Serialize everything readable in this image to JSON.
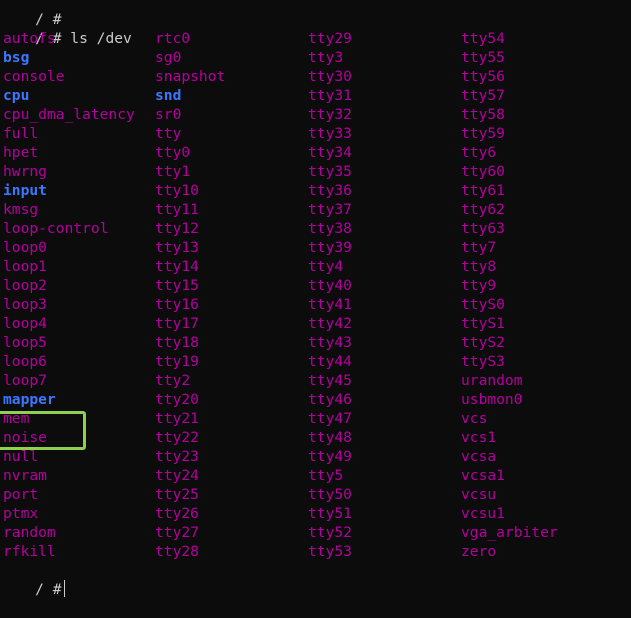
{
  "terminal": {
    "lines_before": [
      "/ #",
      "/ # ls /dev"
    ],
    "final_prompt": "/ #"
  },
  "listing": [
    [
      {
        "n": "autofs",
        "t": "file"
      },
      {
        "n": "rtc0",
        "t": "file"
      },
      {
        "n": "tty29",
        "t": "file"
      },
      {
        "n": "tty54",
        "t": "file"
      }
    ],
    [
      {
        "n": "bsg",
        "t": "dir"
      },
      {
        "n": "sg0",
        "t": "file"
      },
      {
        "n": "tty3",
        "t": "file"
      },
      {
        "n": "tty55",
        "t": "file"
      }
    ],
    [
      {
        "n": "console",
        "t": "file"
      },
      {
        "n": "snapshot",
        "t": "file"
      },
      {
        "n": "tty30",
        "t": "file"
      },
      {
        "n": "tty56",
        "t": "file"
      }
    ],
    [
      {
        "n": "cpu",
        "t": "dir"
      },
      {
        "n": "snd",
        "t": "dir"
      },
      {
        "n": "tty31",
        "t": "file"
      },
      {
        "n": "tty57",
        "t": "file"
      }
    ],
    [
      {
        "n": "cpu_dma_latency",
        "t": "file"
      },
      {
        "n": "sr0",
        "t": "file"
      },
      {
        "n": "tty32",
        "t": "file"
      },
      {
        "n": "tty58",
        "t": "file"
      }
    ],
    [
      {
        "n": "full",
        "t": "file"
      },
      {
        "n": "tty",
        "t": "file"
      },
      {
        "n": "tty33",
        "t": "file"
      },
      {
        "n": "tty59",
        "t": "file"
      }
    ],
    [
      {
        "n": "hpet",
        "t": "file"
      },
      {
        "n": "tty0",
        "t": "file"
      },
      {
        "n": "tty34",
        "t": "file"
      },
      {
        "n": "tty6",
        "t": "file"
      }
    ],
    [
      {
        "n": "hwrng",
        "t": "file"
      },
      {
        "n": "tty1",
        "t": "file"
      },
      {
        "n": "tty35",
        "t": "file"
      },
      {
        "n": "tty60",
        "t": "file"
      }
    ],
    [
      {
        "n": "input",
        "t": "dir"
      },
      {
        "n": "tty10",
        "t": "file"
      },
      {
        "n": "tty36",
        "t": "file"
      },
      {
        "n": "tty61",
        "t": "file"
      }
    ],
    [
      {
        "n": "kmsg",
        "t": "file"
      },
      {
        "n": "tty11",
        "t": "file"
      },
      {
        "n": "tty37",
        "t": "file"
      },
      {
        "n": "tty62",
        "t": "file"
      }
    ],
    [
      {
        "n": "loop-control",
        "t": "file"
      },
      {
        "n": "tty12",
        "t": "file"
      },
      {
        "n": "tty38",
        "t": "file"
      },
      {
        "n": "tty63",
        "t": "file"
      }
    ],
    [
      {
        "n": "loop0",
        "t": "file"
      },
      {
        "n": "tty13",
        "t": "file"
      },
      {
        "n": "tty39",
        "t": "file"
      },
      {
        "n": "tty7",
        "t": "file"
      }
    ],
    [
      {
        "n": "loop1",
        "t": "file"
      },
      {
        "n": "tty14",
        "t": "file"
      },
      {
        "n": "tty4",
        "t": "file"
      },
      {
        "n": "tty8",
        "t": "file"
      }
    ],
    [
      {
        "n": "loop2",
        "t": "file"
      },
      {
        "n": "tty15",
        "t": "file"
      },
      {
        "n": "tty40",
        "t": "file"
      },
      {
        "n": "tty9",
        "t": "file"
      }
    ],
    [
      {
        "n": "loop3",
        "t": "file"
      },
      {
        "n": "tty16",
        "t": "file"
      },
      {
        "n": "tty41",
        "t": "file"
      },
      {
        "n": "ttyS0",
        "t": "file"
      }
    ],
    [
      {
        "n": "loop4",
        "t": "file"
      },
      {
        "n": "tty17",
        "t": "file"
      },
      {
        "n": "tty42",
        "t": "file"
      },
      {
        "n": "ttyS1",
        "t": "file"
      }
    ],
    [
      {
        "n": "loop5",
        "t": "file"
      },
      {
        "n": "tty18",
        "t": "file"
      },
      {
        "n": "tty43",
        "t": "file"
      },
      {
        "n": "ttyS2",
        "t": "file"
      }
    ],
    [
      {
        "n": "loop6",
        "t": "file"
      },
      {
        "n": "tty19",
        "t": "file"
      },
      {
        "n": "tty44",
        "t": "file"
      },
      {
        "n": "ttyS3",
        "t": "file"
      }
    ],
    [
      {
        "n": "loop7",
        "t": "file"
      },
      {
        "n": "tty2",
        "t": "file"
      },
      {
        "n": "tty45",
        "t": "file"
      },
      {
        "n": "urandom",
        "t": "file"
      }
    ],
    [
      {
        "n": "mapper",
        "t": "dir"
      },
      {
        "n": "tty20",
        "t": "file"
      },
      {
        "n": "tty46",
        "t": "file"
      },
      {
        "n": "usbmon0",
        "t": "file"
      }
    ],
    [
      {
        "n": "mem",
        "t": "file"
      },
      {
        "n": "tty21",
        "t": "file"
      },
      {
        "n": "tty47",
        "t": "file"
      },
      {
        "n": "vcs",
        "t": "file"
      }
    ],
    [
      {
        "n": "noise",
        "t": "file"
      },
      {
        "n": "tty22",
        "t": "file"
      },
      {
        "n": "tty48",
        "t": "file"
      },
      {
        "n": "vcs1",
        "t": "file"
      }
    ],
    [
      {
        "n": "null",
        "t": "file"
      },
      {
        "n": "tty23",
        "t": "file"
      },
      {
        "n": "tty49",
        "t": "file"
      },
      {
        "n": "vcsa",
        "t": "file"
      }
    ],
    [
      {
        "n": "nvram",
        "t": "file"
      },
      {
        "n": "tty24",
        "t": "file"
      },
      {
        "n": "tty5",
        "t": "file"
      },
      {
        "n": "vcsa1",
        "t": "file"
      }
    ],
    [
      {
        "n": "port",
        "t": "file"
      },
      {
        "n": "tty25",
        "t": "file"
      },
      {
        "n": "tty50",
        "t": "file"
      },
      {
        "n": "vcsu",
        "t": "file"
      }
    ],
    [
      {
        "n": "ptmx",
        "t": "file"
      },
      {
        "n": "tty26",
        "t": "file"
      },
      {
        "n": "tty51",
        "t": "file"
      },
      {
        "n": "vcsu1",
        "t": "file"
      }
    ],
    [
      {
        "n": "random",
        "t": "file"
      },
      {
        "n": "tty27",
        "t": "file"
      },
      {
        "n": "tty52",
        "t": "file"
      },
      {
        "n": "vga_arbiter",
        "t": "file"
      }
    ],
    [
      {
        "n": "rfkill",
        "t": "file"
      },
      {
        "n": "tty28",
        "t": "file"
      },
      {
        "n": "tty53",
        "t": "file"
      },
      {
        "n": "zero",
        "t": "file"
      }
    ]
  ],
  "colors": {
    "background": "#0c0c0c",
    "text": "#cccccc",
    "file_entry": "#b4009e",
    "dir_entry": "#3b78ff",
    "annotation_box": "#8fd14f"
  }
}
